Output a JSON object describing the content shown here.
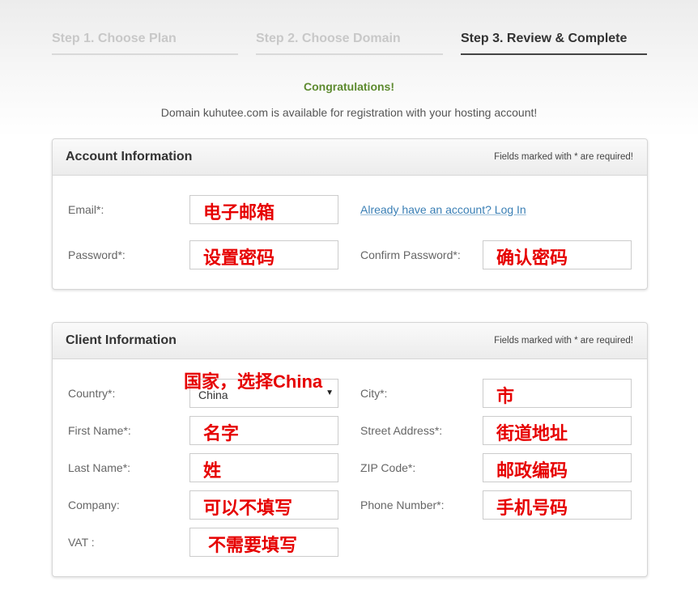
{
  "steps": [
    {
      "label": "Step 1. Choose Plan",
      "active": false
    },
    {
      "label": "Step 2. Choose Domain",
      "active": false
    },
    {
      "label": "Step 3. Review & Complete",
      "active": true
    }
  ],
  "congrats": "Congratulations!",
  "availability": "Domain kuhutee.com is available for registration with your hosting account!",
  "account": {
    "title": "Account Information",
    "note": "Fields marked with * are required!",
    "email_label": "Email*:",
    "email_value": "电子邮箱",
    "login_link": "Already have an account? Log In",
    "password_label": "Password*:",
    "password_value": "设置密码",
    "confirm_label": "Confirm Password*:",
    "confirm_value": "确认密码"
  },
  "client": {
    "title": "Client Information",
    "note": "Fields marked with * are required!",
    "country_label": "Country*:",
    "country_value": "China",
    "country_annotation": "国家，选择China",
    "city_label": "City*:",
    "city_value": "市",
    "first_name_label": "First Name*:",
    "first_name_value": "名字",
    "street_label": "Street Address*:",
    "street_value": "街道地址",
    "last_name_label": "Last Name*:",
    "last_name_value": "姓",
    "zip_label": "ZIP Code*:",
    "zip_value": "邮政编码",
    "company_label": "Company:",
    "company_value": "可以不填写",
    "phone_label": "Phone Number*:",
    "phone_value": "手机号码",
    "vat_label": "VAT :",
    "vat_value": "不需要填写"
  },
  "colors": {
    "congrats": "#5d8a2f",
    "annotation": "#e60000",
    "link": "#3a7fb5"
  }
}
